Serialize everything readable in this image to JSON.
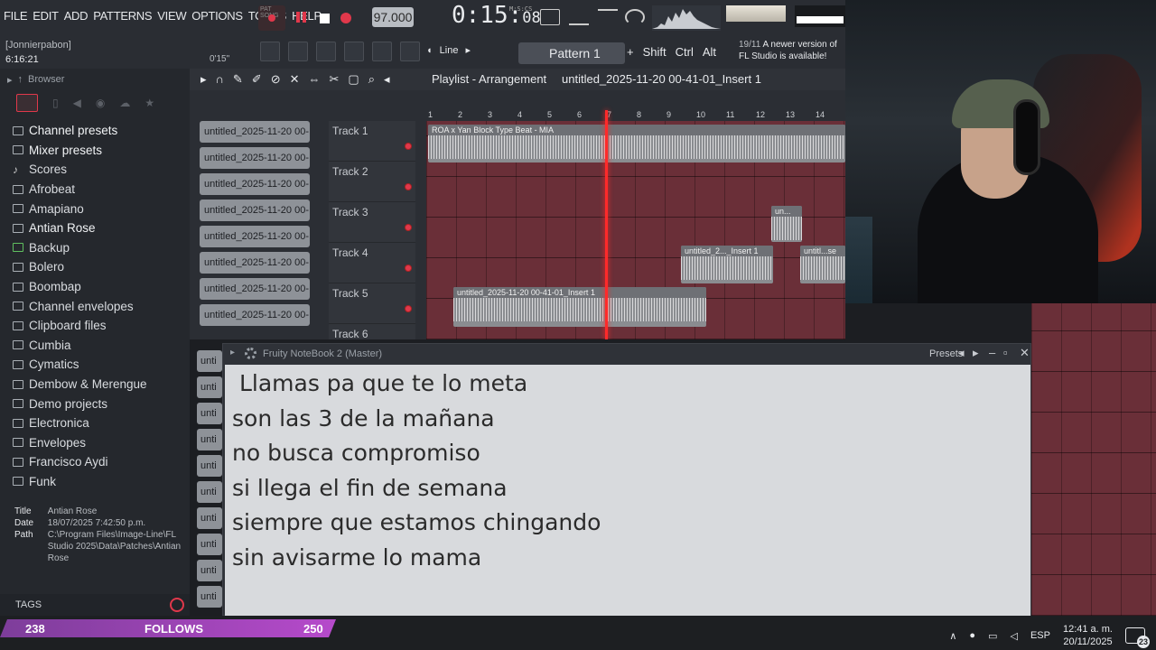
{
  "menu": [
    "FILE",
    "EDIT",
    "ADD",
    "PATTERNS",
    "VIEW",
    "OPTIONS",
    "TOOLS",
    "HELP"
  ],
  "transport": {
    "pat_song_label": "PAT SONG",
    "tempo": "97.000",
    "time_main": "0:15:",
    "time_small": "08",
    "time_unit": "M:S:CS"
  },
  "user": {
    "name": "[Jonnierpabon]",
    "session_time": "6:16:21",
    "hint_sec": "0'15\""
  },
  "toolbar2": {
    "snap": "Line",
    "pattern": "Pattern 1",
    "mod_keys": [
      "Shift",
      "Ctrl",
      "Alt"
    ]
  },
  "news": {
    "count": "19/11",
    "text": "A newer version of FL Studio is available!"
  },
  "browser": {
    "title": "Browser",
    "items": [
      {
        "label": "Channel presets",
        "icon": "preset-icon",
        "style": "bright"
      },
      {
        "label": "Mixer presets",
        "icon": "preset-icon",
        "style": "bright"
      },
      {
        "label": "Scores",
        "icon": "note-icon",
        "style": "normal"
      },
      {
        "label": "Afrobeat",
        "icon": "folder-icon",
        "style": "normal"
      },
      {
        "label": "Amapiano",
        "icon": "folder-icon",
        "style": "normal"
      },
      {
        "label": "Antian Rose",
        "icon": "folder-icon",
        "style": "bright"
      },
      {
        "label": "Backup",
        "icon": "folder-icon",
        "style": "green"
      },
      {
        "label": "Bolero",
        "icon": "folder-icon",
        "style": "normal"
      },
      {
        "label": "Boombap",
        "icon": "folder-icon",
        "style": "normal"
      },
      {
        "label": "Channel envelopes",
        "icon": "folder-icon",
        "style": "normal"
      },
      {
        "label": "Clipboard files",
        "icon": "folder-icon",
        "style": "normal"
      },
      {
        "label": "Cumbia",
        "icon": "folder-icon",
        "style": "normal"
      },
      {
        "label": "Cymatics",
        "icon": "folder-icon",
        "style": "normal"
      },
      {
        "label": "Dembow & Merengue",
        "icon": "folder-icon",
        "style": "normal"
      },
      {
        "label": "Demo projects",
        "icon": "folder-icon",
        "style": "normal"
      },
      {
        "label": "Electronica",
        "icon": "folder-icon",
        "style": "normal"
      },
      {
        "label": "Envelopes",
        "icon": "folder-icon",
        "style": "normal"
      },
      {
        "label": "Francisco Aydi",
        "icon": "folder-icon",
        "style": "normal"
      },
      {
        "label": "Funk",
        "icon": "folder-icon",
        "style": "normal"
      }
    ],
    "info": {
      "title_key": "Title",
      "title_val": "Antian Rose",
      "date_key": "Date",
      "date_val": "18/07/2025 7:42:50 p.m.",
      "path_key": "Path",
      "path_val": "C:\\Program Files\\Image-Line\\FL Studio 2025\\Data\\Patches\\Antian Rose"
    },
    "tags_label": "TAGS"
  },
  "playlist": {
    "title_a": "Playlist - Arrangement",
    "title_sep": "›",
    "title_b": "untitled_2025-11-20 00-41-01_Insert 1",
    "clip_names": [
      "untitled_2025-11-20 00-...",
      "untitled_2025-11-20 00-...",
      "untitled_2025-11-20 00-...",
      "untitled_2025-11-20 00-...",
      "untitled_2025-11-20 00-...",
      "untitled_2025-11-20 00-...",
      "untitled_2025-11-20 00-...",
      "untitled_2025-11-20 00-..."
    ],
    "clip_names_short": [
      "unti",
      "unti",
      "unti",
      "unti",
      "unti",
      "unti",
      "unti",
      "unti",
      "unti",
      "unti"
    ],
    "tracks": [
      "Track 1",
      "Track 2",
      "Track 3",
      "Track 4",
      "Track 5",
      "Track 6"
    ],
    "ruler": [
      "1",
      "2",
      "3",
      "4",
      "5",
      "6",
      "7",
      "8",
      "9",
      "10",
      "11",
      "12",
      "13",
      "14"
    ],
    "clips": [
      {
        "label": "ROA x Yan Block Type Beat - MIA",
        "track": 1
      },
      {
        "label": "un...",
        "track": 3
      },
      {
        "label": "untitled_2..._Insert 1",
        "track": 4
      },
      {
        "label": "untitl...se",
        "track": 4
      },
      {
        "label": "untitled_2025-11-20 00-41-01_Insert 1",
        "track": 5
      }
    ]
  },
  "notebook": {
    "title": "Fruity NoteBook 2 (Master)",
    "presets": "Presets",
    "lines": [
      " Llamas pa que te lo meta",
      "son las 3 de la mañana",
      "no busca compromiso",
      "si llega el fin de semana",
      "siempre que estamos chingando",
      "sin avisarme lo mama"
    ]
  },
  "overlay": {
    "left_count": "238",
    "label": "FOLLOWS",
    "right_count": "250"
  },
  "tray": {
    "lang": "ESP",
    "time": "12:41 a. m.",
    "date": "20/11/2025",
    "notif": "23"
  },
  "colors": {
    "accent_red": "#e0384b",
    "playlist_grid": "#6a2f38",
    "notebook_bg": "#d8dadd",
    "follow_bar": "#b64acb"
  }
}
